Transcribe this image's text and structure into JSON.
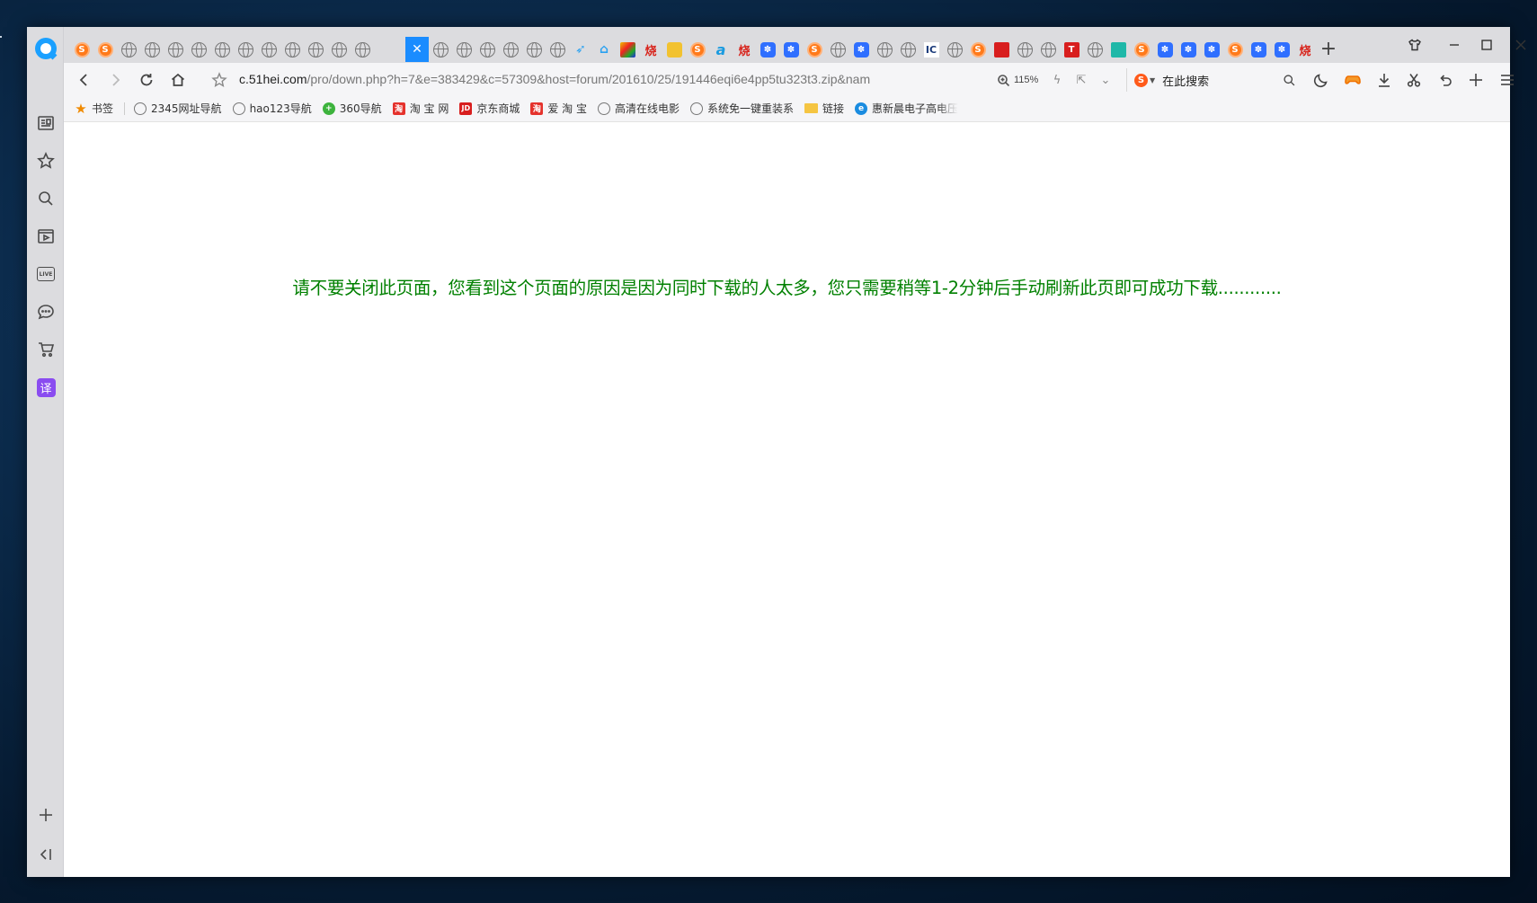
{
  "browser": {
    "url_host": "c.51hei.com",
    "url_path": "/pro/down.php?h=7&e=383429&c=57309&host=forum/201610/25/191446eqi6e4pp5tu323t3.zip&nam",
    "zoom": "115%",
    "search_placeholder": "在此搜索",
    "search_engine_icon": "sogou-icon"
  },
  "bookmarks": [
    {
      "label": "书签",
      "icon": "star-icon"
    },
    {
      "label": "2345网址导航",
      "icon": "globe-icon"
    },
    {
      "label": "hao123导航",
      "icon": "globe-icon"
    },
    {
      "label": "360导航",
      "icon": "360-icon"
    },
    {
      "label": "淘 宝 网",
      "icon": "taobao-icon"
    },
    {
      "label": "京东商城",
      "icon": "jd-icon"
    },
    {
      "label": "爱 淘 宝",
      "icon": "taobao-icon"
    },
    {
      "label": "高清在线电影",
      "icon": "globe-icon"
    },
    {
      "label": "系统免一键重装系",
      "icon": "globe-icon"
    },
    {
      "label": "链接",
      "icon": "folder-icon"
    },
    {
      "label": "惠新晨电子高电压",
      "icon": "hui-icon"
    }
  ],
  "tabs_glyphs": {
    "ic": "IC",
    "baidu": "✽",
    "shao": "烧",
    "acrobat": "a",
    "close": "✕"
  },
  "content": {
    "notice": "请不要关闭此页面，您看到这个页面的原因是因为同时下载的人太多，您只需要稍等1-2分钟后手动刷新此页即可成功下载............"
  },
  "colors": {
    "notice_text": "#008000",
    "active_tab": "#1a8cff"
  }
}
